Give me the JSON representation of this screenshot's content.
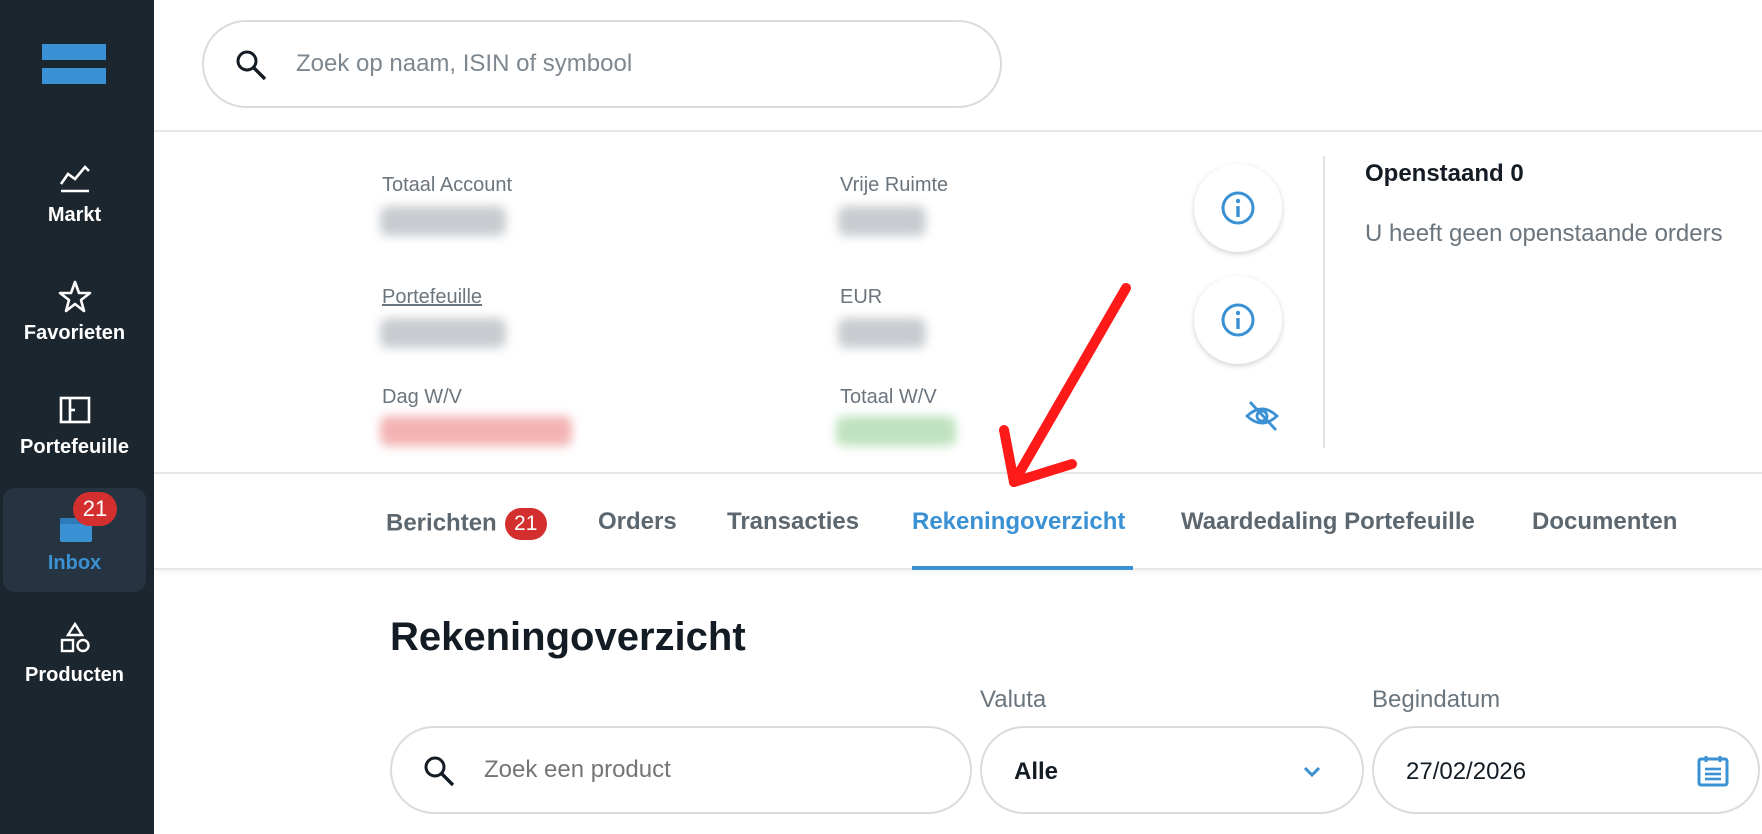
{
  "sidebar": {
    "items": [
      {
        "label": "Markt",
        "icon": "chart-icon"
      },
      {
        "label": "Favorieten",
        "icon": "star-icon"
      },
      {
        "label": "Portefeuille",
        "icon": "portfolio-icon"
      },
      {
        "label": "Inbox",
        "icon": "inbox-icon",
        "badge": "21",
        "active": true
      },
      {
        "label": "Producten",
        "icon": "shapes-icon"
      }
    ]
  },
  "search": {
    "placeholder": "Zoek op naam, ISIN of symbool"
  },
  "account": {
    "totaal_account_label": "Totaal Account",
    "vrije_ruimte_label": "Vrije Ruimte",
    "portefeuille_label": "Portefeuille",
    "eur_label": "EUR",
    "dag_wv_label": "Dag W/V",
    "totaal_wv_label": "Totaal W/V"
  },
  "orders_panel": {
    "title": "Openstaand 0",
    "empty_text": "U heeft geen openstaande orders"
  },
  "tabs": [
    {
      "label": "Berichten",
      "badge": "21"
    },
    {
      "label": "Orders"
    },
    {
      "label": "Transacties"
    },
    {
      "label": "Rekeningoverzicht",
      "active": true
    },
    {
      "label": "Waardedaling Portefeuille"
    },
    {
      "label": "Documenten"
    }
  ],
  "section": {
    "title": "Rekeningoverzicht"
  },
  "filters": {
    "product_search_placeholder": "Zoek een product",
    "valuta_label": "Valuta",
    "valuta_value": "Alle",
    "begindatum_label": "Begindatum",
    "begindatum_value": "27/02/2026"
  },
  "colors": {
    "accent": "#3a91d3",
    "sidebar_bg": "#1c262f",
    "badge": "#d32f2f",
    "annotation_arrow": "#ff0000"
  }
}
